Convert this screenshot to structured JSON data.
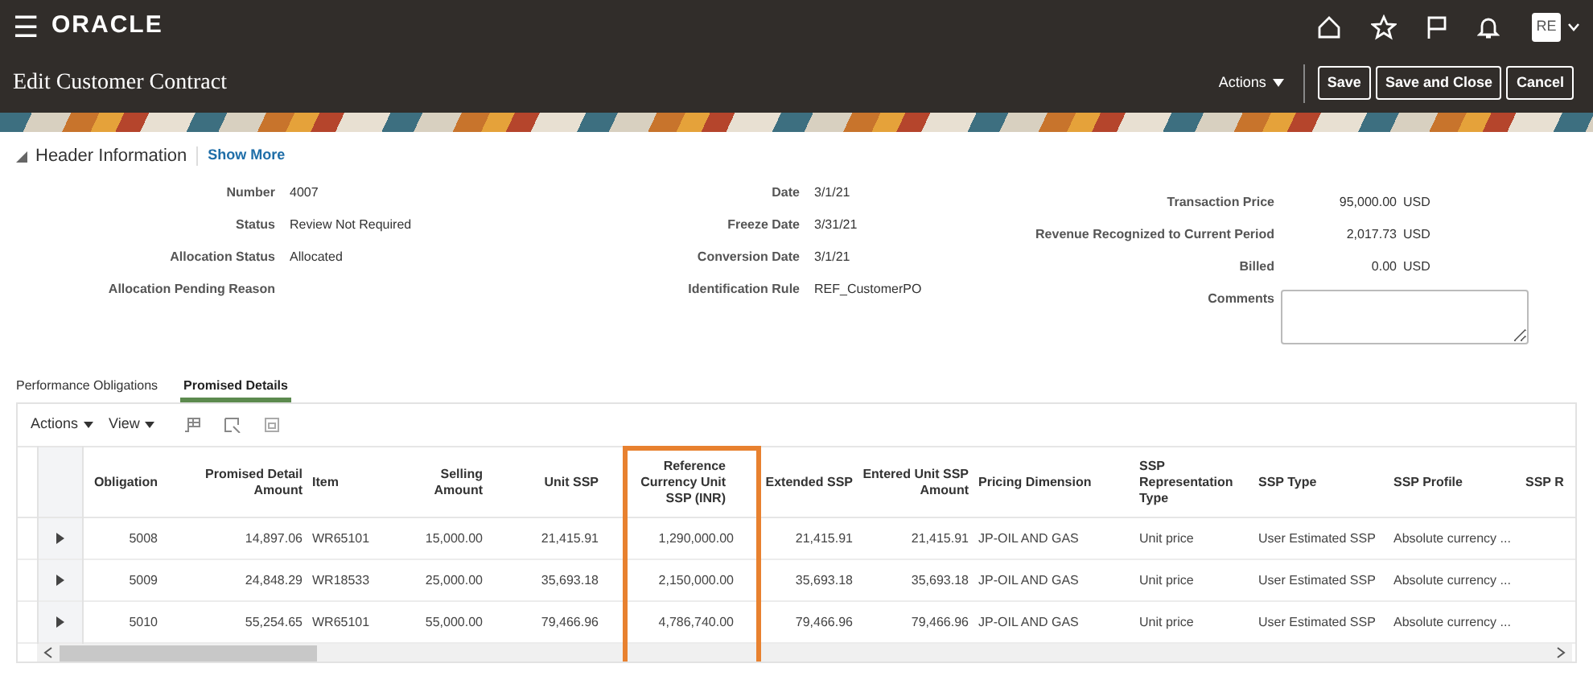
{
  "top_bar": {
    "menu_icon": "☰",
    "logo": "ORACLE",
    "user_initials": "RE"
  },
  "title_bar": {
    "title": "Edit Customer Contract",
    "actions": "Actions",
    "buttons": [
      "Save",
      "Save and Close",
      "Cancel"
    ]
  },
  "header": {
    "section": "Header Information",
    "expanded": true,
    "link": "Show More"
  },
  "fields_left": [
    {
      "label": "Number",
      "value": "4007"
    },
    {
      "label": "Status",
      "value": "Review Not Required"
    },
    {
      "label": "Allocation Status",
      "value": "Allocated"
    },
    {
      "label": "Allocation Pending Reason"
    }
  ],
  "fields_middle": [
    {
      "label": "Date",
      "value": "3/1/21"
    },
    {
      "label": "Freeze Date",
      "value": "3/31/21"
    },
    {
      "label": "Conversion Date",
      "value": "3/1/21"
    },
    {
      "label": "Identification Rule",
      "value": "REF_CustomerPO"
    }
  ],
  "fields_right": [
    {
      "label": "Transaction Price",
      "value": "95,000.00",
      "currency": "USD"
    },
    {
      "label": "Revenue Recognized to Current Period",
      "value": "2,017.73",
      "currency": "USD"
    },
    {
      "label": "Billed",
      "value": "0.00",
      "currency": "USD"
    }
  ],
  "comments": {
    "label": "Comments"
  },
  "tabs": [
    {
      "label": "Performance Obligations",
      "selected": false
    },
    {
      "label": "Promised Details",
      "selected": true
    }
  ],
  "toolbar": {
    "menus": [
      "Actions",
      "View"
    ]
  },
  "table": {
    "columns": [
      {
        "label": "Obligation",
        "kind": "number",
        "highlighted": false
      },
      {
        "label": "Promised Detail Amount",
        "kind": "number",
        "highlighted": false
      },
      {
        "label": "Item",
        "kind": "text",
        "highlighted": false
      },
      {
        "label": "Selling Amount",
        "kind": "number",
        "highlighted": false
      },
      {
        "label": "Unit SSP",
        "kind": "number",
        "highlighted": false
      },
      {
        "label": "Reference Currency Unit SSP (INR)",
        "kind": "number",
        "highlighted": true
      },
      {
        "label": "Extended SSP",
        "kind": "number",
        "highlighted": false
      },
      {
        "label": "Entered Unit SSP Amount",
        "kind": "number",
        "highlighted": false
      },
      {
        "label": "Pricing Dimension",
        "kind": "text",
        "highlighted": false
      },
      {
        "label": "SSP Representation Type",
        "kind": "text",
        "highlighted": false
      },
      {
        "label": "SSP Type",
        "kind": "text",
        "highlighted": false
      },
      {
        "label": "SSP Profile",
        "kind": "text",
        "highlighted": false
      },
      {
        "label": "SSP R",
        "kind": "text",
        "highlighted": false
      }
    ],
    "rows": [
      {
        "expanded": false,
        "cells": [
          "5008",
          "14,897.06",
          "WR65101",
          "15,000.00",
          "21,415.91",
          "1,290,000.00",
          "21,415.91",
          "21,415.91",
          "JP-OIL AND GAS",
          "Unit price",
          "User Estimated SSP",
          "Absolute currency ..."
        ]
      },
      {
        "expanded": false,
        "cells": [
          "5009",
          "24,848.29",
          "WR18533",
          "25,000.00",
          "35,693.18",
          "2,150,000.00",
          "35,693.18",
          "35,693.18",
          "JP-OIL AND GAS",
          "Unit price",
          "User Estimated SSP",
          "Absolute currency ..."
        ]
      },
      {
        "expanded": false,
        "cells": [
          "5010",
          "55,254.65",
          "WR65101",
          "55,000.00",
          "79,466.96",
          "4,786,740.00",
          "79,466.96",
          "79,466.96",
          "JP-OIL AND GAS",
          "Unit price",
          "User Estimated SSP",
          "Absolute currency ..."
        ]
      }
    ]
  }
}
